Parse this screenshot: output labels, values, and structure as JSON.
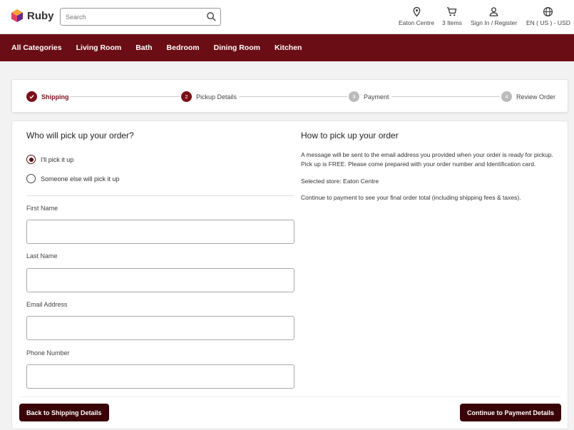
{
  "brand": {
    "name": "Ruby"
  },
  "search": {
    "placeholder": "Search"
  },
  "utility": {
    "store": "Eaton Centre",
    "cart": "3 Items",
    "account": "Sign In / Register",
    "locale": "EN ( US ) - USD"
  },
  "nav": {
    "items": [
      "All Categories",
      "Living Room",
      "Bath",
      "Bedroom",
      "Dining Room",
      "Kitchen"
    ]
  },
  "steps": [
    {
      "marker": "",
      "label": "Shipping",
      "state": "done"
    },
    {
      "marker": "2",
      "label": "Pickup Details",
      "state": "active"
    },
    {
      "marker": "3",
      "label": "Payment",
      "state": "pending"
    },
    {
      "marker": "4",
      "label": "Review Order",
      "state": "pending"
    }
  ],
  "pickup": {
    "title": "Who will pick up your order?",
    "options": [
      {
        "label": "I'll pick it up",
        "checked": true
      },
      {
        "label": "Someone else will pick it up",
        "checked": false
      }
    ],
    "fields": [
      "First Name",
      "Last Name",
      "Email Address",
      "Phone Number"
    ]
  },
  "info": {
    "title": "How to pick up your order",
    "paragraph1": "A message will be sent to the email address you provided when your order is ready for pickup. Pick up is FREE. Please come prepared with your order number and Identification card.",
    "store": "Selected store: Eaton Centre",
    "note": "Continue to payment to see your final order total (including shipping fees & taxes)."
  },
  "actions": {
    "back": "Back to Shipping Details",
    "continue": "Continue to Payment Details"
  },
  "colors": {
    "brand": "#6b0d14",
    "button": "#3a0307",
    "logo_pink": "#e4405f",
    "logo_orange": "#f7a23b",
    "logo_purple": "#6a2a8c"
  }
}
